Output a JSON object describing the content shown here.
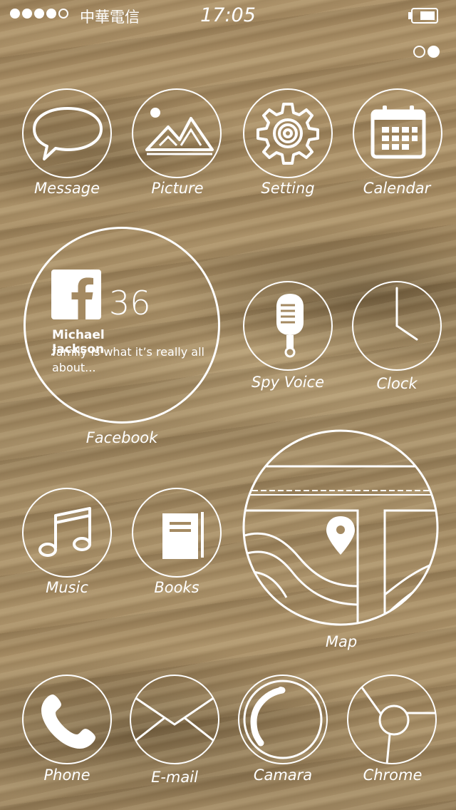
{
  "status_bar": {
    "signal_bars_filled": 4,
    "signal_bars_total": 5,
    "carrier": "中華電信",
    "time": "17:05",
    "battery_level": 0.6
  },
  "page_indicator": {
    "pages": 2,
    "current": 2
  },
  "apps": {
    "message": {
      "label": "Message",
      "icon": "speech-bubble-icon"
    },
    "picture": {
      "label": "Picture",
      "icon": "mountain-picture-icon"
    },
    "setting": {
      "label": "Setting",
      "icon": "gear-icon"
    },
    "calendar": {
      "label": "Calendar",
      "icon": "calendar-icon"
    },
    "facebook": {
      "label": "Facebook",
      "icon": "facebook-icon",
      "count": "36",
      "post_author": "Michael Jackson",
      "post_text": "family is what it’s really all about..."
    },
    "spy_voice": {
      "label": "Spy Voice",
      "icon": "microphone-icon"
    },
    "clock": {
      "label": "Clock",
      "icon": "clock-icon"
    },
    "music": {
      "label": "Music",
      "icon": "music-note-icon"
    },
    "books": {
      "label": "Books",
      "icon": "book-icon"
    },
    "map": {
      "label": "Map",
      "icon": "map-pin-icon"
    },
    "phone": {
      "label": "Phone",
      "icon": "phone-handset-icon"
    },
    "email": {
      "label": "E-mail",
      "icon": "envelope-icon"
    },
    "camera": {
      "label": "Camara",
      "icon": "camera-lens-icon"
    },
    "chrome": {
      "label": "Chrome",
      "icon": "chrome-icon"
    }
  },
  "colors": {
    "foreground": "#ffffff",
    "wallpaper": "#a48a62"
  }
}
